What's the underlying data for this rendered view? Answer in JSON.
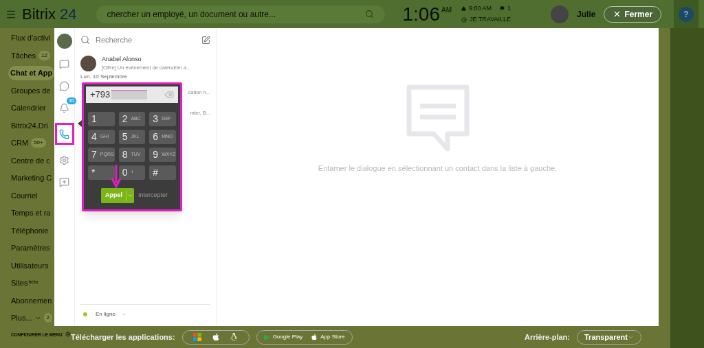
{
  "header": {
    "logo_word": "Bitrix",
    "logo_number": "24",
    "search": {
      "placeholder": "chercher un employé, un document ou autre..."
    },
    "time": "1:06",
    "time_suffix": "AM",
    "alarm": "9:00 AM",
    "flags": "1",
    "work_status": "JE TRAVAILLE",
    "user_name": "Julie",
    "close_button": "Fermer",
    "help": "?"
  },
  "menu": {
    "items": [
      {
        "label": "Flux d'activi"
      },
      {
        "label": "Tâches",
        "badge": "12"
      },
      {
        "label": "Chat et App",
        "selected": true
      },
      {
        "label": "Groupes de"
      },
      {
        "label": "Calendrier"
      },
      {
        "label": "Bitrix24.Dri"
      },
      {
        "label": "CRM",
        "badge": "50+"
      },
      {
        "label": "Centre de c"
      },
      {
        "label": "Marketing C"
      },
      {
        "label": "Courriel"
      },
      {
        "label": "Temps et ra"
      },
      {
        "label": "Téléphonie"
      },
      {
        "label": "Paramètres"
      },
      {
        "label": "Utilisateurs"
      },
      {
        "label": "Sites",
        "sup": "beta"
      },
      {
        "label": "Abonnemen"
      },
      {
        "label": "Plus...",
        "badge": "2",
        "caret": true
      }
    ],
    "configure": "CONFIGURER LE MENU"
  },
  "messenger": {
    "nav": [
      {
        "kind": "avatar",
        "selected": false
      },
      {
        "kind": "chat",
        "selected": false
      },
      {
        "kind": "openlines",
        "selected": false
      },
      {
        "kind": "notifications",
        "selected": false,
        "badge": "30"
      },
      {
        "kind": "phone",
        "selected": true
      },
      {
        "kind": "settings",
        "selected": false
      },
      {
        "kind": "newchat",
        "selected": false
      }
    ],
    "search": {
      "placeholder": "Recherche"
    },
    "recent": {
      "name": "Anabel Alonso",
      "preview": "[Offre] Un événement de calendrier a..."
    },
    "date_separator": "Lun. 10 Septembre",
    "hidden_rows": [
      {
        "preview": "cation h..."
      },
      {
        "preview": "mier, B..."
      }
    ],
    "status": "En ligne",
    "empty_text": "Entamer le dialogue en sélectionnant un contact dans la liste à gauche."
  },
  "dialpad": {
    "number": "+793",
    "keys": [
      {
        "digit": "1"
      },
      {
        "digit": "2",
        "letters": "ABC"
      },
      {
        "digit": "3",
        "letters": "DEF"
      },
      {
        "digit": "4",
        "letters": "GHI"
      },
      {
        "digit": "5",
        "letters": "JKL"
      },
      {
        "digit": "6",
        "letters": "MNO"
      },
      {
        "digit": "7",
        "letters": "PQRS"
      },
      {
        "digit": "8",
        "letters": "TUV"
      },
      {
        "digit": "9",
        "letters": "WXYZ"
      },
      {
        "digit": "*"
      },
      {
        "digit": "0",
        "letters": "+"
      },
      {
        "digit": "#"
      }
    ],
    "call_button": "Appel",
    "intercept": "Intercepter"
  },
  "footer": {
    "download_label": "Télécharger les applications:",
    "store_links": [
      "Google Play",
      "App Store"
    ],
    "background_label": "Arrière-plan:",
    "background_value": "Transparent"
  }
}
